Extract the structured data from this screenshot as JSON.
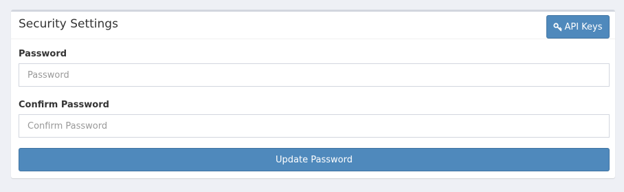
{
  "card": {
    "title": "Security Settings",
    "api_keys_button": {
      "label": "API Keys",
      "icon": "key-icon"
    }
  },
  "form": {
    "password": {
      "label": "Password",
      "placeholder": "Password",
      "value": ""
    },
    "confirm_password": {
      "label": "Confirm Password",
      "placeholder": "Confirm Password",
      "value": ""
    },
    "submit_label": "Update Password"
  },
  "colors": {
    "page_background": "#eef0f5",
    "primary_button": "#4f89bc",
    "card_top_border": "#d2d6de"
  }
}
